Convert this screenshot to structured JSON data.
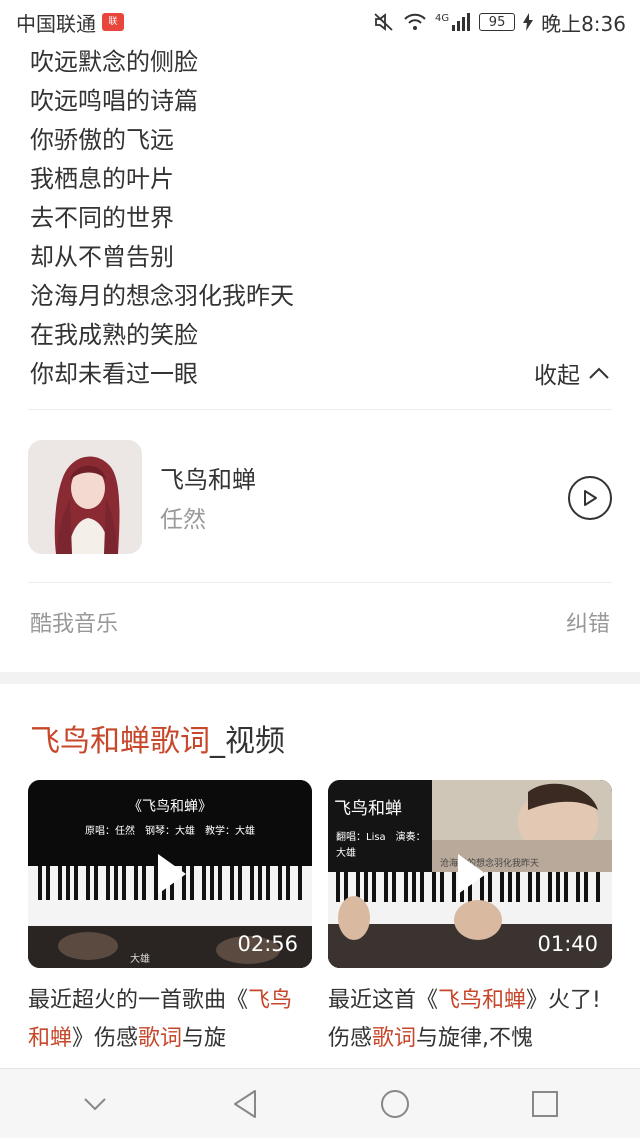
{
  "status_bar": {
    "carrier": "中国联通",
    "battery": "95",
    "time": "晚上8:36",
    "network": "4G"
  },
  "lyrics": {
    "lines": [
      "吹远默念的侧脸",
      "吹远鸣唱的诗篇",
      "你骄傲的飞远",
      "我栖息的叶片",
      "去不同的世界",
      "却从不曾告别",
      "沧海月的想念羽化我昨天",
      "在我成熟的笑脸",
      "你却未看过一眼"
    ],
    "collapse_label": "收起"
  },
  "song": {
    "title": "飞鸟和蝉",
    "artist": "任然"
  },
  "source": {
    "provider": "酷我音乐",
    "report_label": "纠错"
  },
  "video_section": {
    "title_highlight": "飞鸟和蝉歌词",
    "title_rest": "_视频",
    "videos": [
      {
        "duration": "02:56",
        "thumb_title": "《飞鸟和蝉》",
        "thumb_credits": "原唱：任然　钢琴：大雄　教学：大雄",
        "thumb_bottom_text": "大雄",
        "caption_parts": [
          {
            "t": "最近超火的一首歌曲《",
            "hl": false
          },
          {
            "t": "飞鸟和蝉",
            "hl": true
          },
          {
            "t": "》伤感",
            "hl": false
          },
          {
            "t": "歌词",
            "hl": true
          },
          {
            "t": "与旋",
            "hl": false
          }
        ]
      },
      {
        "duration": "01:40",
        "thumb_title": "飞鸟和蝉",
        "thumb_credits": "翻唱：Lisa　演奏：大雄",
        "thumb_bottom_text": "沧海月的想念羽化我昨天",
        "caption_parts": [
          {
            "t": "最近这首《",
            "hl": false
          },
          {
            "t": "飞鸟和蝉",
            "hl": true
          },
          {
            "t": "》火了!伤感",
            "hl": false
          },
          {
            "t": "歌词",
            "hl": true
          },
          {
            "t": "与旋律,不愧",
            "hl": false
          }
        ]
      }
    ]
  },
  "colors": {
    "accent": "#c7472b",
    "text": "#333333",
    "muted": "#999999"
  }
}
